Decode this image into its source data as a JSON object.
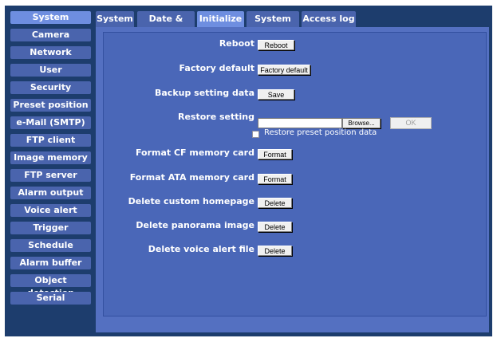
{
  "sidebar": {
    "items": [
      {
        "label": "System"
      },
      {
        "label": "Camera"
      },
      {
        "label": "Network"
      },
      {
        "label": "User"
      },
      {
        "label": "Security"
      },
      {
        "label": "Preset position"
      },
      {
        "label": "e-Mail (SMTP)"
      },
      {
        "label": "FTP client"
      },
      {
        "label": "Image memory"
      },
      {
        "label": "FTP server"
      },
      {
        "label": "Alarm output"
      },
      {
        "label": "Voice alert"
      },
      {
        "label": "Trigger"
      },
      {
        "label": "Schedule"
      },
      {
        "label": "Alarm buffer"
      },
      {
        "label": "Object detection"
      },
      {
        "label": "Serial"
      }
    ]
  },
  "tabs": [
    {
      "label": "System"
    },
    {
      "label": "Date & time"
    },
    {
      "label": "Initialize"
    },
    {
      "label": "System log"
    },
    {
      "label": "Access log"
    }
  ],
  "form": {
    "reboot": {
      "label": "Reboot",
      "button": "Reboot"
    },
    "factory_default": {
      "label": "Factory default",
      "button": "Factory default"
    },
    "backup": {
      "label": "Backup setting data",
      "button": "Save"
    },
    "restore": {
      "label": "Restore setting",
      "file_value": "",
      "browse": "Browse...",
      "ok": "OK",
      "checkbox_label": "Restore preset position data"
    },
    "format_cf": {
      "label": "Format CF memory card",
      "button": "Format"
    },
    "format_ata": {
      "label": "Format ATA memory card",
      "button": "Format"
    },
    "delete_homepage": {
      "label": "Delete custom homepage",
      "button": "Delete"
    },
    "delete_panorama": {
      "label": "Delete panorama image",
      "button": "Delete"
    },
    "delete_voice": {
      "label": "Delete voice alert file",
      "button": "Delete"
    }
  },
  "colors": {
    "background": "#1d3d6d",
    "nav": "#4a64ad",
    "nav_active": "#6e8ee0",
    "panel": "#4a67b8"
  }
}
